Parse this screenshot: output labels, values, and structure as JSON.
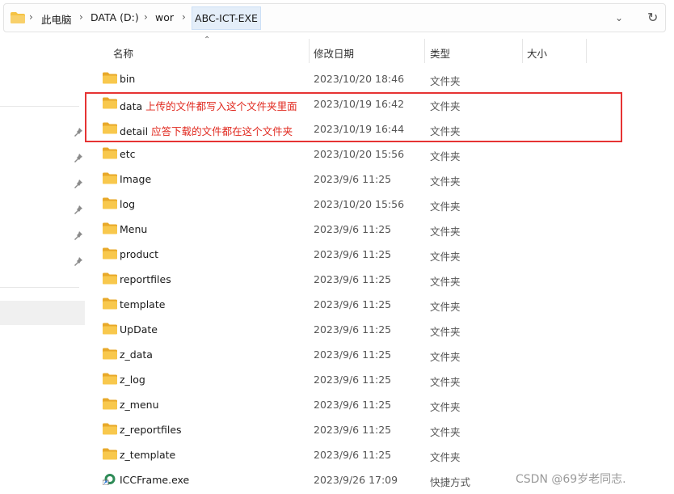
{
  "breadcrumb": {
    "root_separator": "›",
    "items": [
      "此电脑",
      "DATA (D:)",
      "wor"
    ],
    "current": "ABC-ICT-EXE"
  },
  "columns": {
    "name": "名称",
    "date": "修改日期",
    "type": "类型",
    "size": "大小"
  },
  "files": [
    {
      "name": "bin",
      "note": "",
      "date": "2023/10/20 18:46",
      "type": "文件夹",
      "icon": "folder-icon"
    },
    {
      "name": "data",
      "note": "上传的文件都写入这个文件夹里面",
      "date": "2023/10/19 16:42",
      "type": "文件夹",
      "icon": "folder-icon"
    },
    {
      "name": "detail",
      "note": "应答下载的文件都在这个文件夹",
      "date": "2023/10/19 16:44",
      "type": "文件夹",
      "icon": "folder-icon"
    },
    {
      "name": "etc",
      "note": "",
      "date": "2023/10/20 15:56",
      "type": "文件夹",
      "icon": "folder-icon"
    },
    {
      "name": "Image",
      "note": "",
      "date": "2023/9/6 11:25",
      "type": "文件夹",
      "icon": "folder-icon"
    },
    {
      "name": "log",
      "note": "",
      "date": "2023/10/20 15:56",
      "type": "文件夹",
      "icon": "folder-icon"
    },
    {
      "name": "Menu",
      "note": "",
      "date": "2023/9/6 11:25",
      "type": "文件夹",
      "icon": "folder-icon"
    },
    {
      "name": "product",
      "note": "",
      "date": "2023/9/6 11:25",
      "type": "文件夹",
      "icon": "folder-icon"
    },
    {
      "name": "reportfiles",
      "note": "",
      "date": "2023/9/6 11:25",
      "type": "文件夹",
      "icon": "folder-icon"
    },
    {
      "name": "template",
      "note": "",
      "date": "2023/9/6 11:25",
      "type": "文件夹",
      "icon": "folder-icon"
    },
    {
      "name": "UpDate",
      "note": "",
      "date": "2023/9/6 11:25",
      "type": "文件夹",
      "icon": "folder-icon"
    },
    {
      "name": "z_data",
      "note": "",
      "date": "2023/9/6 11:25",
      "type": "文件夹",
      "icon": "folder-icon"
    },
    {
      "name": "z_log",
      "note": "",
      "date": "2023/9/6 11:25",
      "type": "文件夹",
      "icon": "folder-icon"
    },
    {
      "name": "z_menu",
      "note": "",
      "date": "2023/9/6 11:25",
      "type": "文件夹",
      "icon": "folder-icon"
    },
    {
      "name": "z_reportfiles",
      "note": "",
      "date": "2023/9/6 11:25",
      "type": "文件夹",
      "icon": "folder-icon"
    },
    {
      "name": "z_template",
      "note": "",
      "date": "2023/9/6 11:25",
      "type": "文件夹",
      "icon": "folder-icon"
    },
    {
      "name": "ICCFrame.exe",
      "note": "",
      "date": "2023/9/26 17:09",
      "type": "快捷方式",
      "icon": "shortcut-icon"
    }
  ],
  "watermark": "CSDN @69岁老同志.",
  "colors": {
    "folder": "#f5c344",
    "highlight": "#e63333",
    "note_text": "#e0281e",
    "breadcrumb_selected": "#e4eef9"
  }
}
